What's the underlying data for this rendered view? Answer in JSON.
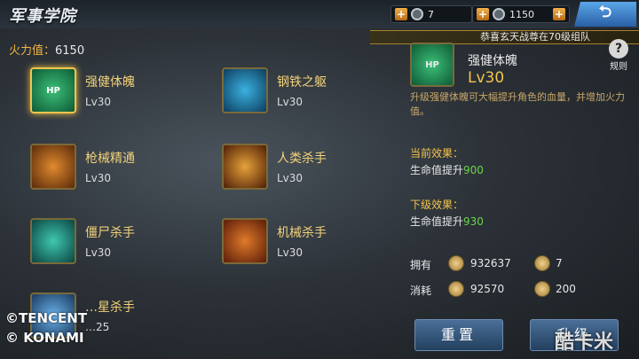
{
  "header": {
    "title": "军事学院",
    "resources": [
      {
        "icon": "medal-icon",
        "value": "7"
      },
      {
        "icon": "shield-coin-icon",
        "value": "1150"
      }
    ],
    "back_icon": "back-arrow-icon"
  },
  "power": {
    "label": "火力值：",
    "value": "6150"
  },
  "notice": "恭喜玄天战尊在70级组队",
  "rules_label": "规则",
  "skills": [
    {
      "name": "强健体魄",
      "level": "Lv30",
      "icon": "hp-body-icon",
      "icon_text": "HP",
      "selected": true
    },
    {
      "name": "钢铁之躯",
      "level": "Lv30",
      "icon": "steel-body-icon"
    },
    {
      "name": "枪械精通",
      "level": "Lv30",
      "icon": "gun-icon"
    },
    {
      "name": "人类杀手",
      "level": "Lv30",
      "icon": "skull-icon"
    },
    {
      "name": "僵尸杀手",
      "level": "Lv30",
      "icon": "zombie-icon"
    },
    {
      "name": "机械杀手",
      "level": "Lv30",
      "icon": "mech-icon"
    },
    {
      "name": "…星杀手",
      "level": "…25",
      "icon": "star-killer-icon"
    }
  ],
  "detail": {
    "name": "强健体魄",
    "level": "Lv30",
    "icon_text": "HP",
    "description": "升级强健体魄可大幅提升角色的血量，并增加火力值。",
    "current_title": "当前效果：",
    "current_text": "生命值提升",
    "current_value": "900",
    "next_title": "下级效果：",
    "next_text": "生命值提升",
    "next_value": "930",
    "own_label": "拥有",
    "own_coin": "932637",
    "own_medal": "7",
    "cost_label": "消耗",
    "cost_coin": "92570",
    "cost_medal": "200"
  },
  "buttons": {
    "reset": "重置",
    "upgrade": "升级"
  },
  "copyright": [
    "©TENCENT",
    "© KONAMI"
  ],
  "watermark": "酷卡米"
}
